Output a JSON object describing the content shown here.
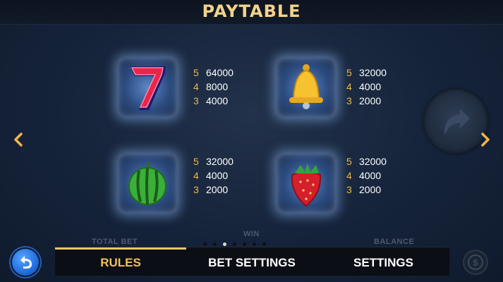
{
  "header": {
    "title": "PAYTABLE"
  },
  "symbols": [
    {
      "name": "seven-icon",
      "pays": [
        {
          "count": "5",
          "value": "64000"
        },
        {
          "count": "4",
          "value": "8000"
        },
        {
          "count": "3",
          "value": "4000"
        }
      ]
    },
    {
      "name": "bell-icon",
      "pays": [
        {
          "count": "5",
          "value": "32000"
        },
        {
          "count": "4",
          "value": "4000"
        },
        {
          "count": "3",
          "value": "2000"
        }
      ]
    },
    {
      "name": "watermelon-icon",
      "pays": [
        {
          "count": "5",
          "value": "32000"
        },
        {
          "count": "4",
          "value": "4000"
        },
        {
          "count": "3",
          "value": "2000"
        }
      ]
    },
    {
      "name": "strawberry-icon",
      "pays": [
        {
          "count": "5",
          "value": "32000"
        },
        {
          "count": "4",
          "value": "4000"
        },
        {
          "count": "3",
          "value": "2000"
        }
      ]
    }
  ],
  "background_labels": {
    "total_bet": "TOTAL BET",
    "win": "WIN",
    "balance": "BALANCE"
  },
  "pagination": {
    "total": 7,
    "active_index": 2
  },
  "tabs": [
    {
      "label": "RULES",
      "active": true
    },
    {
      "label": "BET SETTINGS",
      "active": false
    },
    {
      "label": "SETTINGS",
      "active": false
    }
  ],
  "colors": {
    "title": "#f2d28a",
    "count": "#f0b64a",
    "active_tab": "#efc15e",
    "tab_indicator": "#e6c66a"
  }
}
